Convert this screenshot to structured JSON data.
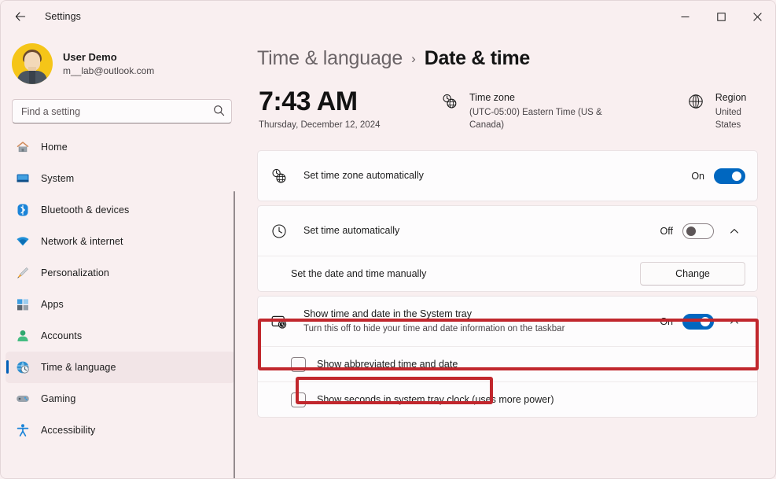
{
  "window": {
    "title": "Settings",
    "back_icon": "back-arrow-icon",
    "minimize_label": "Minimize",
    "maximize_label": "Maximize",
    "close_label": "Close"
  },
  "account": {
    "name": "User Demo",
    "email": "m__lab@outlook.com",
    "avatar_icon": "user-avatar"
  },
  "search": {
    "placeholder": "Find a setting",
    "value": "",
    "icon": "search-icon"
  },
  "sidebar": {
    "items": [
      {
        "label": "Home",
        "icon": "home-icon",
        "selected": false
      },
      {
        "label": "System",
        "icon": "system-icon",
        "selected": false
      },
      {
        "label": "Bluetooth & devices",
        "icon": "bluetooth-icon",
        "selected": false
      },
      {
        "label": "Network & internet",
        "icon": "network-icon",
        "selected": false
      },
      {
        "label": "Personalization",
        "icon": "brush-icon",
        "selected": false
      },
      {
        "label": "Apps",
        "icon": "apps-icon",
        "selected": false
      },
      {
        "label": "Accounts",
        "icon": "accounts-icon",
        "selected": false
      },
      {
        "label": "Time & language",
        "icon": "clock-globe-icon",
        "selected": true
      },
      {
        "label": "Gaming",
        "icon": "gamepad-icon",
        "selected": false
      },
      {
        "label": "Accessibility",
        "icon": "accessibility-icon",
        "selected": false
      }
    ]
  },
  "breadcrumb": {
    "parent": "Time & language",
    "separator": "›",
    "current": "Date & time"
  },
  "summary": {
    "time": "7:43 AM",
    "date": "Thursday, December 12, 2024",
    "timezone": {
      "icon": "clock-globe-icon",
      "title": "Time zone",
      "value": "(UTC-05:00) Eastern Time (US & Canada)"
    },
    "region": {
      "icon": "globe-icon",
      "title": "Region",
      "value": "United States"
    }
  },
  "settings": {
    "set_time_zone_automatically": {
      "icon": "clock-globe-icon",
      "title": "Set time zone automatically",
      "state_label": "On",
      "state": true
    },
    "set_time_automatically": {
      "icon": "clock-icon",
      "title": "Set time automatically",
      "state_label": "Off",
      "state": false,
      "expand_icon": "chevron-up-icon"
    },
    "set_date_time_manually": {
      "title": "Set the date and time manually",
      "button_label": "Change"
    },
    "show_time_date_system_tray": {
      "icon": "taskbar-clock-icon",
      "title": "Show time and date in the System tray",
      "subtitle": "Turn this off to hide your time and date information on the taskbar",
      "state_label": "On",
      "state": true,
      "expand_icon": "chevron-up-icon",
      "highlighted": true
    },
    "show_abbreviated_time_date": {
      "label": "Show abbreviated time and date",
      "checked": false,
      "highlighted": true
    },
    "show_seconds_system_tray": {
      "label": "Show seconds in system tray clock (uses more power)",
      "checked": false
    }
  },
  "colors": {
    "accent": "#0067c0",
    "selection_bar": "#005fb8",
    "highlight_box": "#c1272d",
    "sidebar_bg": "#f9eff0",
    "card_bg": "#fdfcfd"
  }
}
